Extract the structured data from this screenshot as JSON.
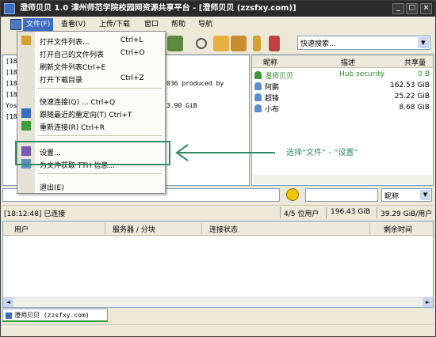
{
  "window": {
    "title": "澄师贝贝 1.0 漳州师范学院校园网资源共享平台 - [澄师贝贝 (zzsfxy.com)]",
    "buttons": [
      "_",
      "□",
      "×"
    ]
  },
  "menubar": {
    "items": [
      "文件(F)",
      "查看(V)",
      "上传/下载",
      "窗口",
      "帮助",
      "导航"
    ]
  },
  "search": {
    "value": "快速搜索..."
  },
  "file_menu": {
    "items": [
      {
        "label": "打开文件列表...",
        "shortcut": "Ctrl+L",
        "icon": "folder-open-icon"
      },
      {
        "label": "打开自己的文件列表",
        "shortcut": "Ctrl+O",
        "icon": ""
      },
      {
        "label": "刷新文件列表Ctrl+E",
        "shortcut": "",
        "icon": ""
      },
      {
        "label": "打开下载目录",
        "shortcut": "Ctrl+Z",
        "icon": ""
      },
      {
        "label": "快速连接(Q) ... Ctrl+Q",
        "shortcut": "",
        "icon": ""
      },
      {
        "label": "跟随最近的重定向(T) Ctrl+T",
        "shortcut": "",
        "icon": "redirect-icon"
      },
      {
        "label": "重新连接(R) Ctrl+R",
        "shortcut": "",
        "icon": "reconnect-icon"
      },
      {
        "label": "设置...",
        "shortcut": "",
        "icon": "settings-icon"
      },
      {
        "label": "为文件获取 TTH 信息...",
        "shortcut": "",
        "icon": "tth-icon"
      },
      {
        "label": "退出(E)",
        "shortcut": "",
        "icon": ""
      }
    ]
  },
  "chat": {
    "lines": [
      "[18:",
      "[18:",
      "[18:",
      "[18:",
      "Yosh",
      "[18:"
    ],
    "fragments": [
      "036 produced by",
      "3.90 GiB"
    ]
  },
  "users": {
    "columns": [
      "昵称",
      "描述",
      "共享量"
    ],
    "rows": [
      {
        "nick": "澄师贝贝",
        "desc": "Hub security",
        "share": "0 B",
        "color": "#2e8a2e"
      },
      {
        "nick": "阿鹏",
        "desc": "",
        "share": "162.53 GiB",
        "color": "#000000"
      },
      {
        "nick": "超锋",
        "desc": "",
        "share": "25.22 GiB",
        "color": "#000000"
      },
      {
        "nick": "小布",
        "desc": "",
        "share": "8.68 GiB",
        "color": "#000000"
      }
    ]
  },
  "filter": {
    "sort_value": "昵称"
  },
  "status": {
    "log": "[18:12:48] 已连接",
    "users": "4/5 位用户",
    "total_share": "196.43 GiB",
    "per_user": "39.29 GiB/用户"
  },
  "queue": {
    "columns": [
      "用户",
      "服务器 / 分块",
      "连接状态",
      "剩余时间"
    ]
  },
  "tabs": [
    {
      "label": "澄师贝贝 (zzsfxy.com)"
    }
  ],
  "annotation": {
    "text": "选择“文件” - “设置”",
    "color": "#2e8a64"
  }
}
